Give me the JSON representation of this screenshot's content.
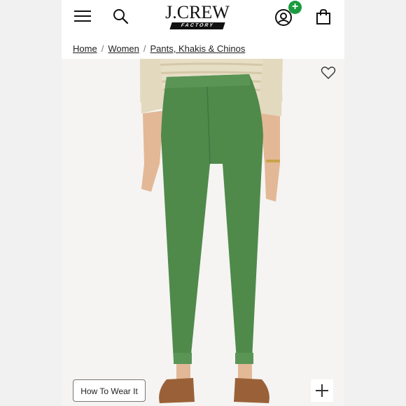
{
  "header": {
    "logo_main": "J.CREW",
    "logo_sub": "FACTORY",
    "account_badge": "+"
  },
  "icons": {
    "menu": "hamburger-menu-icon",
    "search": "magnifier-search-icon",
    "account": "user-circle-icon",
    "bag": "shopping-bag-icon",
    "favorite": "heart-outline-icon",
    "zoom": "plus-icon"
  },
  "breadcrumb": {
    "items": [
      "Home",
      "Women",
      "Pants, Khakis & Chinos"
    ],
    "separator": "/"
  },
  "product_image": {
    "description_alt": "Model wearing green pull-on pants, back view",
    "pants_color": "#4f8a4b",
    "sweater_color": "#e6ddc4"
  },
  "buttons": {
    "how_to_wear": "How To Wear It"
  },
  "colors": {
    "badge_green": "#1a9b3f",
    "text": "#222222"
  }
}
